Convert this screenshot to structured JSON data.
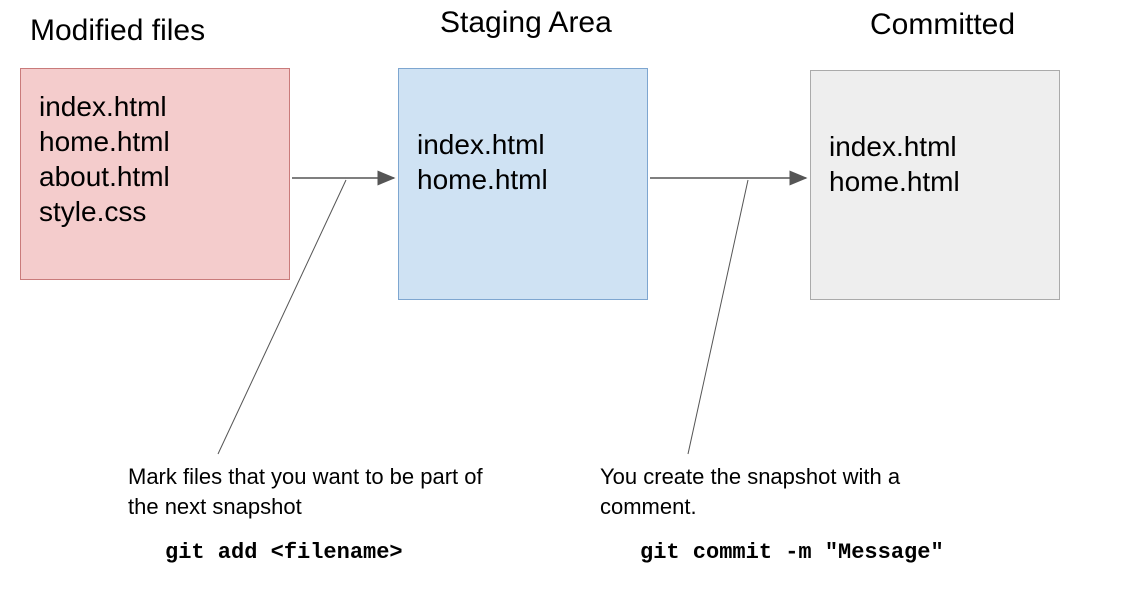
{
  "stages": {
    "modified": {
      "title": "Modified files",
      "files": [
        "index.html",
        "home.html",
        "about.html",
        "style.css"
      ]
    },
    "staging": {
      "title": "Staging Area",
      "files": [
        "index.html",
        "home.html"
      ]
    },
    "committed": {
      "title": "Committed",
      "files": [
        "index.html",
        "home.html"
      ]
    }
  },
  "captions": {
    "add": {
      "text": "Mark files that you want to be part of the next snapshot",
      "command": "git add <filename>"
    },
    "commit": {
      "text": "You create the snapshot with a comment.",
      "command": "git commit -m \"Message\""
    }
  },
  "colors": {
    "modified_bg": "#f4cccc",
    "staging_bg": "#cfe2f3",
    "committed_bg": "#eeeeee"
  }
}
